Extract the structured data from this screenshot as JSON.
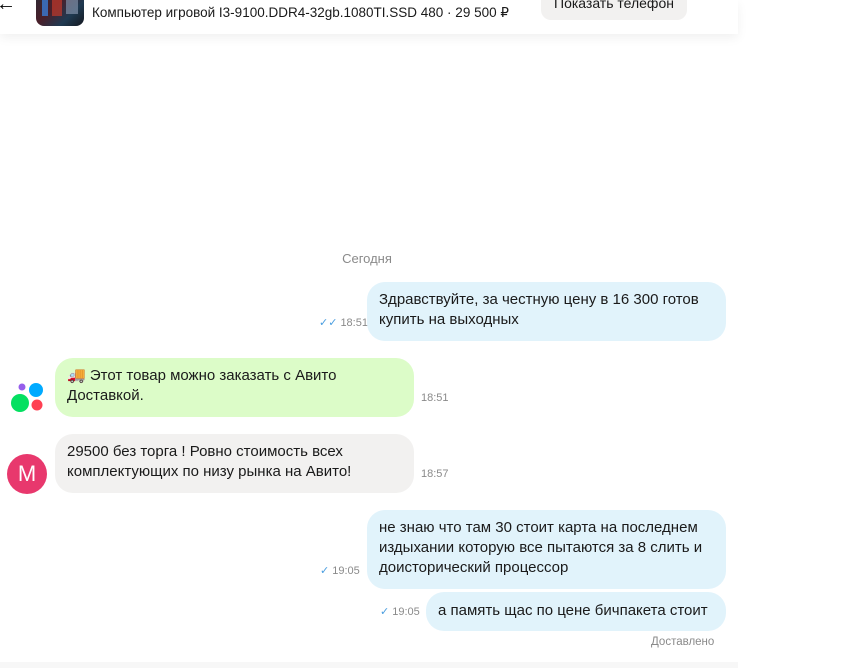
{
  "header": {
    "listing_title": "Компьютер игровой I3-9100.DDR4-32gb.1080TI.SSD 480 · 29 500 ₽",
    "phone_button_label": "Показать телефон",
    "back_icon": "←",
    "more_icon": "···"
  },
  "chat": {
    "date_separator": "Сегодня",
    "messages": [
      {
        "text": "Здравствуйте, за честную цену в 16 300 готов купить на выходных",
        "time": "18:51",
        "status": "✓✓"
      },
      {
        "text": "🚚 Этот товар можно заказать с Авито Доставкой.",
        "time": "18:51"
      },
      {
        "text": "29500 без торга ! Ровно стоимость всех комплектующих по низу рынка на Авито!",
        "time": "18:57"
      },
      {
        "text": "не знаю что там 30 стоит карта на последнем издыхании которую все пытаются за 8 слить и доисторический процессор",
        "time": "19:05",
        "status": "✓"
      },
      {
        "text": "а память щас по цене бичпакета стоит",
        "time": "19:05",
        "status": "✓"
      }
    ],
    "seller_avatar_letter": "М",
    "delivered_label": "Доставлено"
  },
  "colors": {
    "outgoing_bubble": "#e1f3fb",
    "incoming_bubble": "#f2f1f0",
    "promo_bubble": "#dcfcc8",
    "avatar": "#e8386d",
    "check": "#4a9ee0"
  }
}
